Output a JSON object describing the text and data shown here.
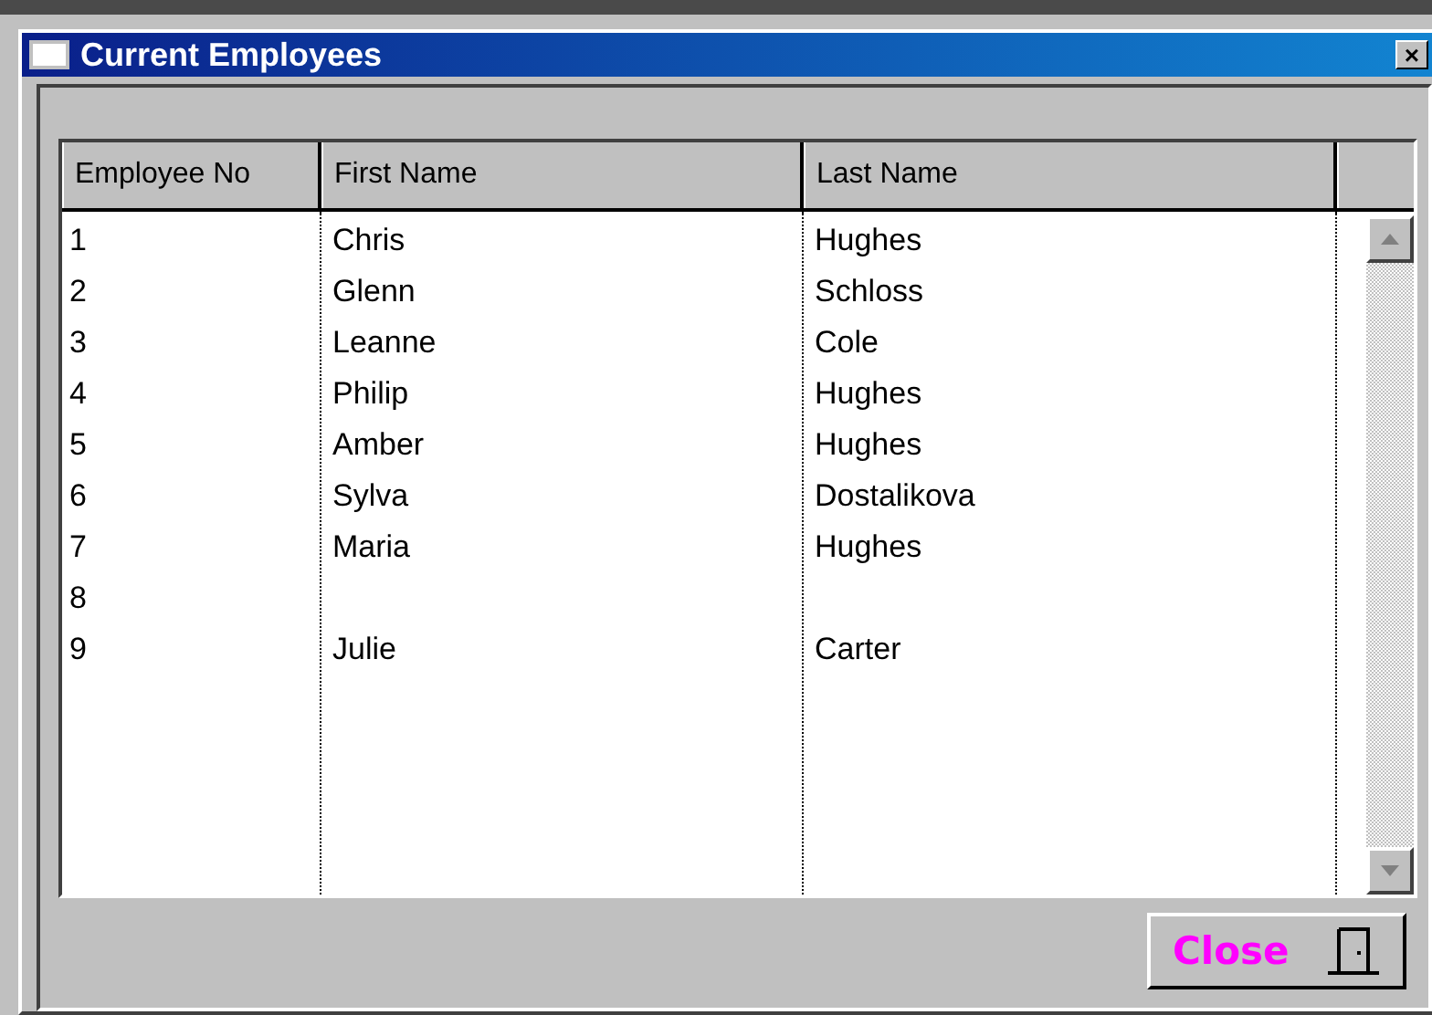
{
  "window": {
    "title": "Current Employees",
    "close_glyph": "×"
  },
  "table": {
    "columns": [
      "Employee No",
      "First Name",
      "Last Name"
    ],
    "rows": [
      [
        "1",
        "Chris",
        "Hughes"
      ],
      [
        "2",
        "Glenn",
        "Schloss"
      ],
      [
        "3",
        "Leanne",
        "Cole"
      ],
      [
        "4",
        "Philip",
        "Hughes"
      ],
      [
        "5",
        "Amber",
        "Hughes"
      ],
      [
        "6",
        "Sylva",
        "Dostalikova"
      ],
      [
        "7",
        "Maria",
        "Hughes"
      ],
      [
        "8",
        "",
        ""
      ],
      [
        "9",
        "Julie",
        "Carter"
      ]
    ]
  },
  "buttons": [
    {
      "label": "Close"
    }
  ]
}
